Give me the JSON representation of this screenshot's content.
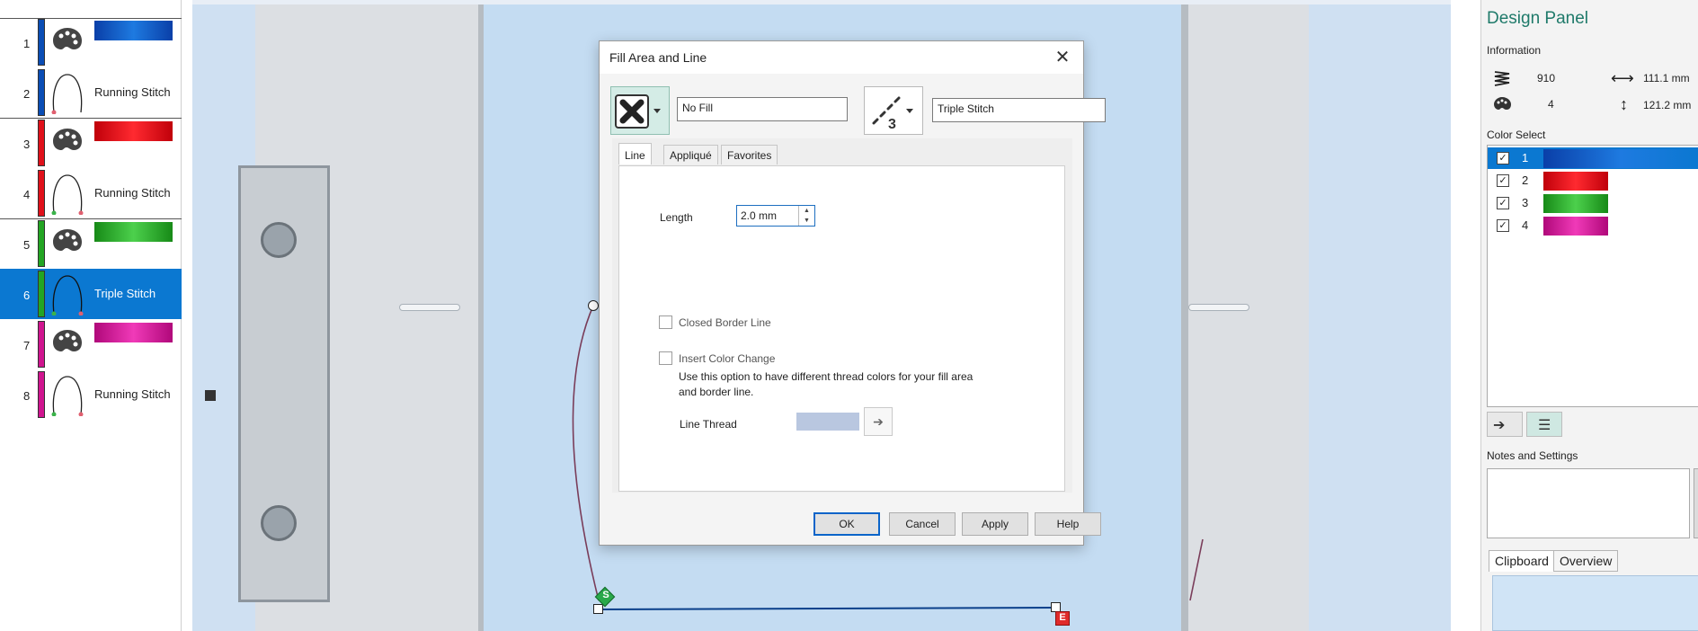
{
  "sequence": {
    "rows": [
      {
        "num": "1",
        "type": "color",
        "color": "#0a4db5",
        "label": ""
      },
      {
        "num": "2",
        "type": "stitch",
        "color": "#0a4db5",
        "label": "Running Stitch"
      },
      {
        "num": "3",
        "type": "color",
        "color": "#e0101a",
        "label": ""
      },
      {
        "num": "4",
        "type": "stitch",
        "color": "#e0101a",
        "label": "Running Stitch"
      },
      {
        "num": "5",
        "type": "color",
        "color": "#23a523",
        "label": ""
      },
      {
        "num": "6",
        "type": "stitch",
        "color": "#23a523",
        "label": "Triple Stitch",
        "selected": true
      },
      {
        "num": "7",
        "type": "color",
        "color": "#d0148f",
        "label": ""
      },
      {
        "num": "8",
        "type": "stitch",
        "color": "#d0148f",
        "label": "Running Stitch"
      }
    ]
  },
  "dialog": {
    "title": "Fill Area and Line",
    "close_glyph": "✕",
    "fill_name": "No Fill",
    "line_name": "Triple Stitch",
    "tabs": [
      "Line",
      "Appliqué",
      "Favorites"
    ],
    "length_label": "Length",
    "length_value": "2.0 mm",
    "closed_border_label": "Closed Border Line",
    "insert_color_label": "Insert Color Change",
    "insert_color_desc": "Use this option to have different thread colors for your fill area and border line.",
    "line_thread_label": "Line Thread",
    "buttons": {
      "ok": "OK",
      "cancel": "Cancel",
      "apply": "Apply",
      "help": "Help"
    }
  },
  "canvas": {
    "start_marker": "S",
    "end_marker": "E"
  },
  "design_panel": {
    "title": "Design Panel",
    "information_label": "Information",
    "stitch_count": "910",
    "width": "111.1 mm",
    "color_count": "4",
    "height": "121.2 mm",
    "color_select_label": "Color Select",
    "colors": [
      {
        "num": "1",
        "color": "#0a4db5",
        "checked": true,
        "selected": true
      },
      {
        "num": "2",
        "color": "#e0101a",
        "checked": true
      },
      {
        "num": "3",
        "color": "#23a523",
        "checked": true
      },
      {
        "num": "4",
        "color": "#d0148f",
        "checked": true
      }
    ],
    "notes_label": "Notes and Settings",
    "bottom_tabs": [
      "Clipboard",
      "Overview"
    ]
  }
}
